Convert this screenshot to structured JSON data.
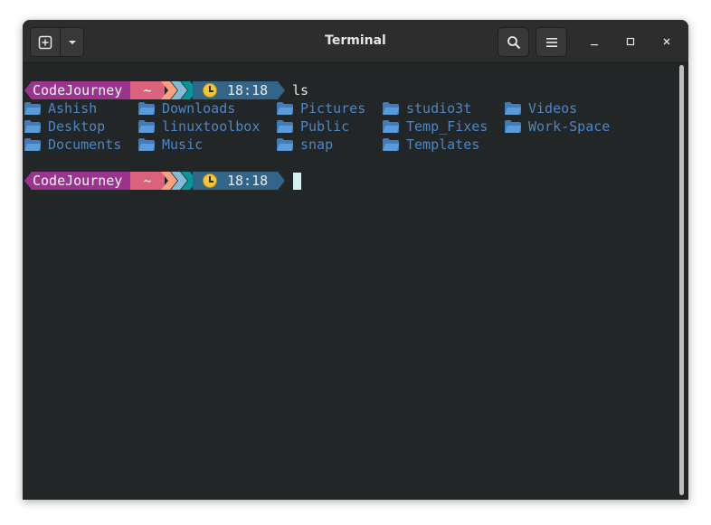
{
  "window": {
    "title": "Terminal"
  },
  "prompt": {
    "user": "CodeJourney",
    "dir": "~",
    "time": "18:18",
    "command": "ls"
  },
  "ls_output": [
    [
      "Ashish",
      "Downloads",
      "Pictures",
      "studio3t",
      "Videos"
    ],
    [
      "Desktop",
      "linuxtoolbox",
      "Public",
      "Temp_Fixes",
      "Work-Space"
    ],
    [
      "Documents",
      "Music",
      "snap",
      "Templates"
    ]
  ],
  "colors": {
    "terminal_bg": "#232627",
    "headerbar_bg": "#2d2d2d",
    "directory": "#4b87c6",
    "prompt_user_bg": "#9a348e",
    "prompt_dir_bg": "#da627d",
    "prompt_arrows": [
      "#fca17d",
      "#86bbd8",
      "#06969a"
    ],
    "prompt_time_bg": "#33658a",
    "cursor": "#d9f0f1"
  },
  "icons": {
    "new_tab": "new-tab-icon",
    "dropdown": "chevron-down-icon",
    "search": "search-icon",
    "menu": "hamburger-menu-icon",
    "minimize": "minimize-icon",
    "maximize": "maximize-icon",
    "close": "close-icon",
    "folder": "folder-icon",
    "clock": "clock-icon"
  }
}
